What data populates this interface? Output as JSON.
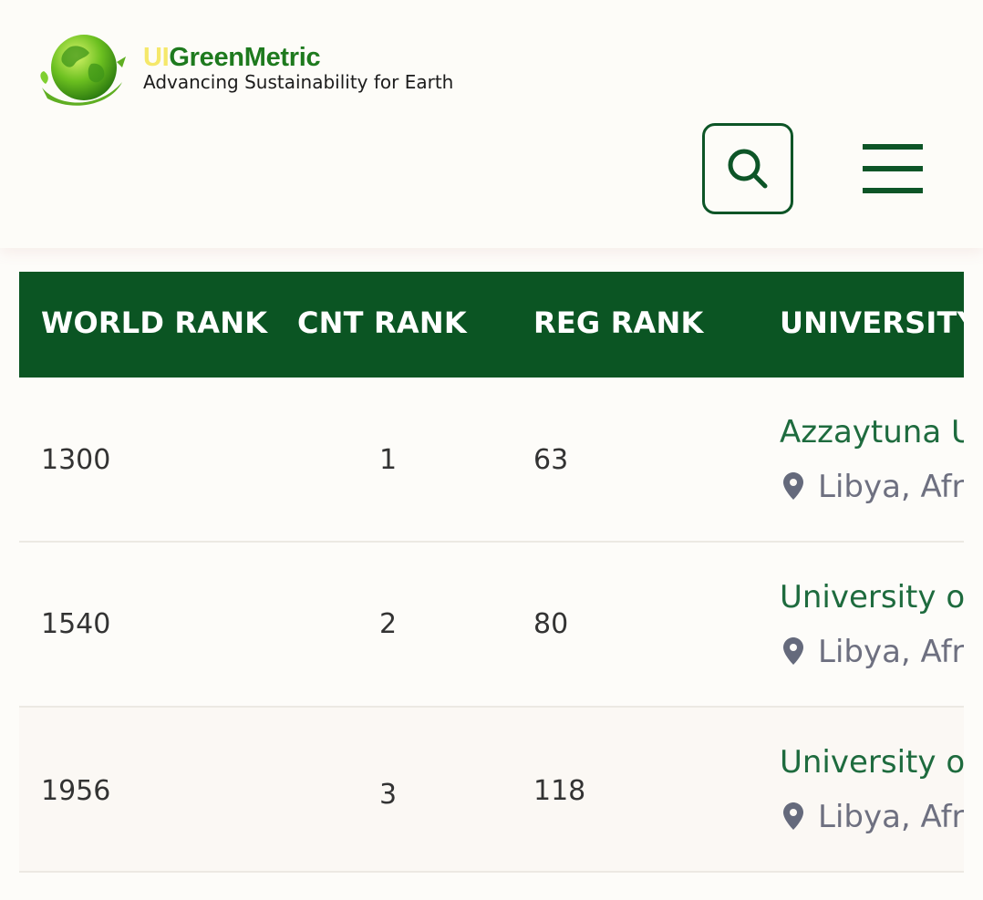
{
  "brand": {
    "name_prefix": "UI",
    "name_rest": "GreenMetric",
    "tagline": "Advancing Sustainability for Earth",
    "colors": {
      "prefix": "#f5e86a",
      "name": "#1e7a1e",
      "accent": "#0d5527"
    }
  },
  "header": {
    "search_icon": "search-icon",
    "menu_icon": "hamburger-menu-icon"
  },
  "table": {
    "header_color": "#0b5523",
    "columns": [
      "WORLD RANK",
      "CNT RANK",
      "REG RANK",
      "UNIVERSITY"
    ],
    "rows": [
      {
        "world_rank": "1300",
        "cnt_rank": "1",
        "reg_rank": "63",
        "university": "Azzaytuna U",
        "location": "Libya, Afr"
      },
      {
        "world_rank": "1540",
        "cnt_rank": "2",
        "reg_rank": "80",
        "university": "University o",
        "location": "Libya, Afr"
      },
      {
        "world_rank": "1956",
        "cnt_rank": "3",
        "reg_rank": "118",
        "university": "University o",
        "location": "Libya, Afr"
      }
    ]
  }
}
